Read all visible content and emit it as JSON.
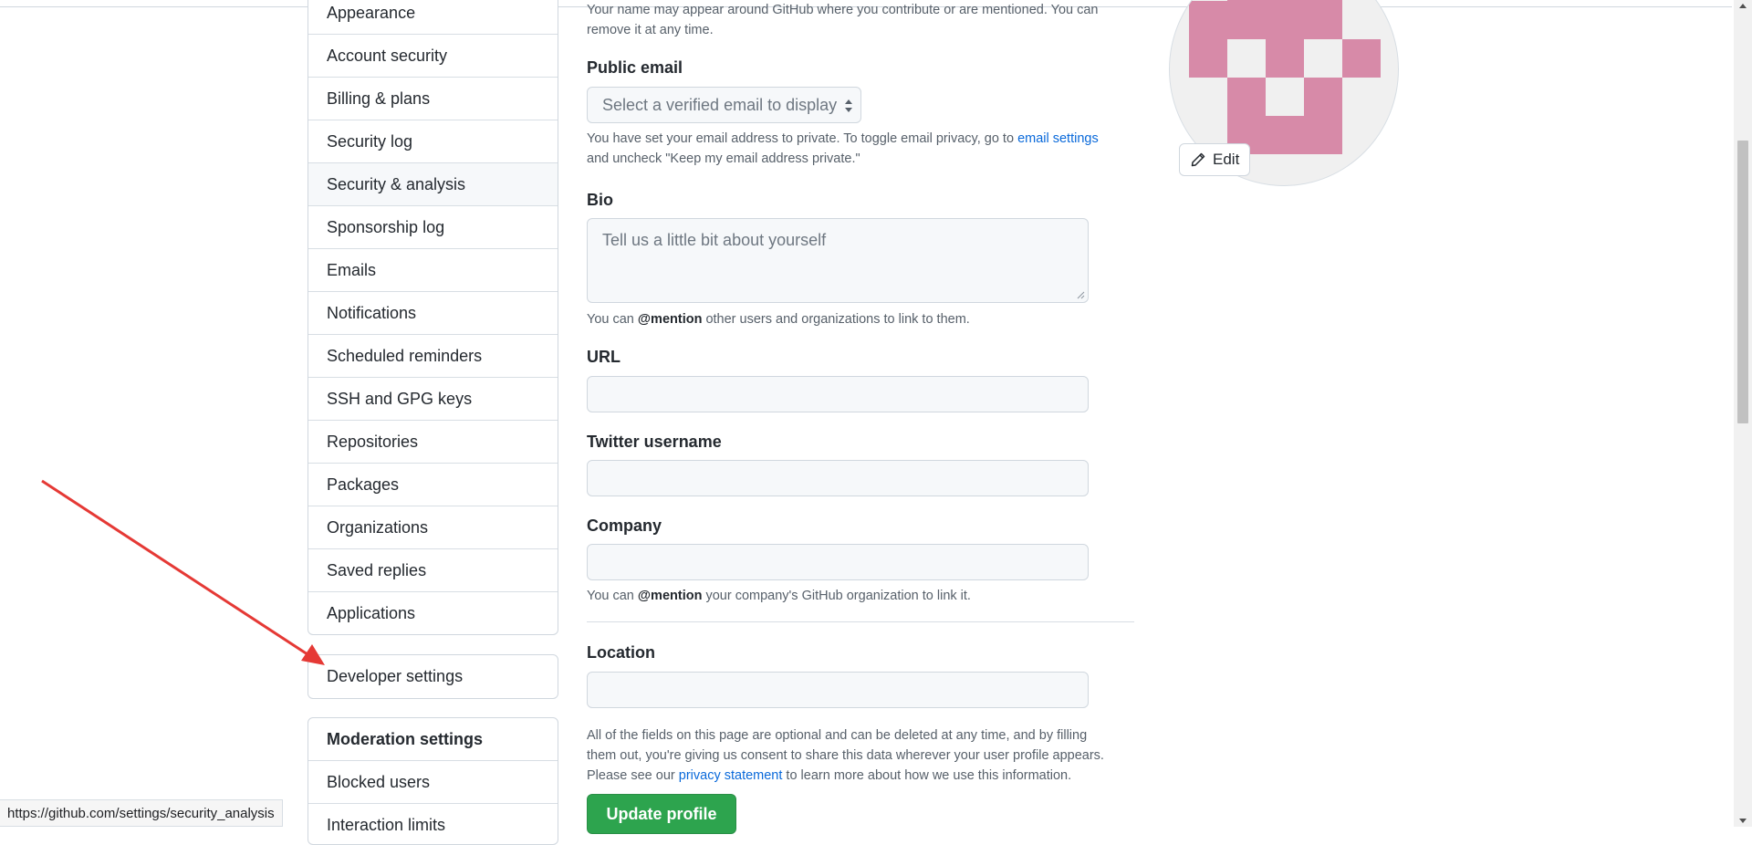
{
  "sidebar": {
    "items": [
      {
        "label": "Appearance",
        "selected": false
      },
      {
        "label": "Account security",
        "selected": false
      },
      {
        "label": "Billing & plans",
        "selected": false
      },
      {
        "label": "Security log",
        "selected": false
      },
      {
        "label": "Security & analysis",
        "selected": true
      },
      {
        "label": "Sponsorship log",
        "selected": false
      },
      {
        "label": "Emails",
        "selected": false
      },
      {
        "label": "Notifications",
        "selected": false
      },
      {
        "label": "Scheduled reminders",
        "selected": false
      },
      {
        "label": "SSH and GPG keys",
        "selected": false
      },
      {
        "label": "Repositories",
        "selected": false
      },
      {
        "label": "Packages",
        "selected": false
      },
      {
        "label": "Organizations",
        "selected": false
      },
      {
        "label": "Saved replies",
        "selected": false
      },
      {
        "label": "Applications",
        "selected": false
      }
    ],
    "developer_settings": "Developer settings",
    "moderation": {
      "heading": "Moderation settings",
      "items": [
        "Blocked users",
        "Interaction limits"
      ]
    }
  },
  "profile_form": {
    "name_note": "Your name may appear around GitHub where you contribute or are mentioned. You can remove it at any time.",
    "name_note_line1": "Your name may appear around GitHub where you contribute or are mentioned. You can",
    "name_note_line2": "remove it at any time.",
    "public_email": {
      "label": "Public email",
      "select_value": "Select a verified email to display",
      "note_line1_pre": "You have set your email address to private. To toggle email privacy, go to ",
      "note_link": "email settings",
      "note_line2": "and uncheck \"Keep my email address private.\""
    },
    "bio": {
      "label": "Bio",
      "placeholder": "Tell us a little bit about yourself",
      "note_pre": "You can ",
      "note_mention": "@mention",
      "note_post": " other users and organizations to link to them."
    },
    "url": {
      "label": "URL",
      "value": ""
    },
    "twitter": {
      "label": "Twitter username",
      "value": ""
    },
    "company": {
      "label": "Company",
      "value": "",
      "note_pre": "You can ",
      "note_mention": "@mention",
      "note_post": " your company's GitHub organization to link it."
    },
    "location": {
      "label": "Location",
      "value": ""
    },
    "consent": {
      "line1": "All of the fields on this page are optional and can be deleted at any time, and by filling",
      "line2": "them out, you're giving us consent to share this data wherever your user profile appears.",
      "line3_pre": "Please see our ",
      "line3_link": "privacy statement",
      "line3_post": " to learn more about how we use this information."
    },
    "submit_label": "Update profile"
  },
  "avatar": {
    "edit_label": "Edit",
    "colors": {
      "fg": "#d78aa8",
      "bg": "#f0f0f0"
    }
  },
  "status_bar": {
    "url": "https://github.com/settings/security_analysis"
  },
  "annotation": {
    "arrow_color": "#e53935"
  },
  "icons": {
    "edit": "pencil-icon",
    "select": "select-arrows-icon"
  }
}
